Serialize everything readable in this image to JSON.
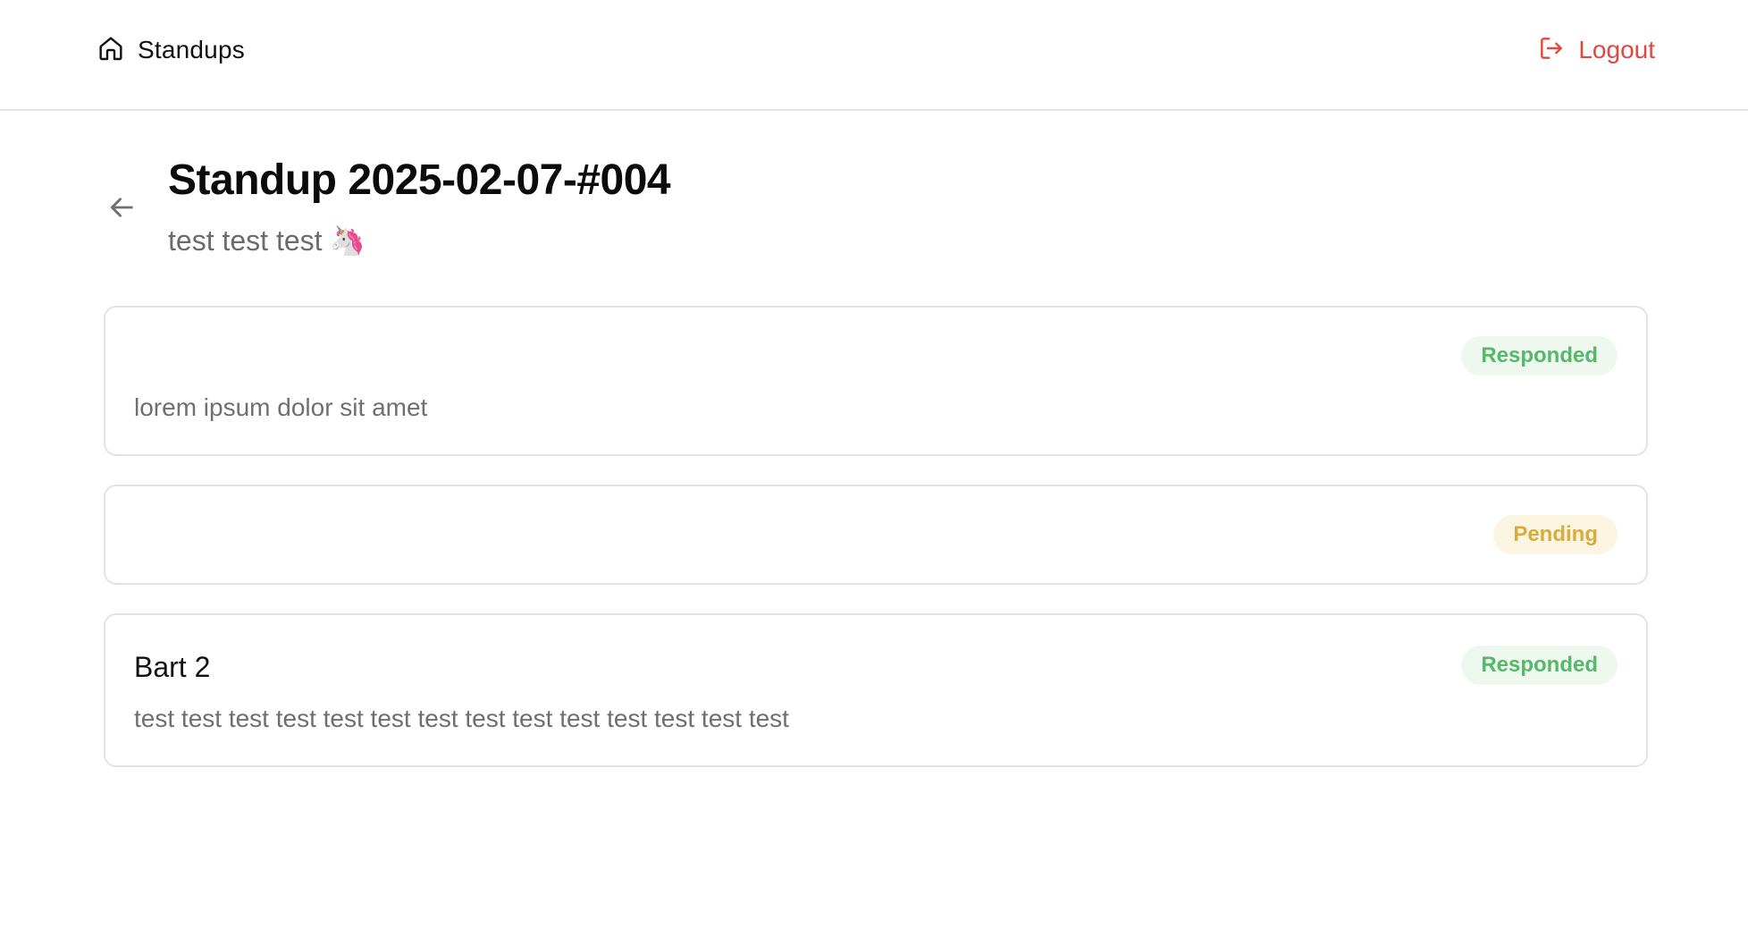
{
  "header": {
    "brand_label": "Standups",
    "logout_label": "Logout"
  },
  "page": {
    "title": "Standup 2025-02-07-#004",
    "subtitle": "test test test 🦄"
  },
  "responses": [
    {
      "name": "",
      "status": "Responded",
      "text": "lorem ipsum dolor sit amet"
    },
    {
      "name": "",
      "status": "Pending",
      "text": ""
    },
    {
      "name": "Bart 2",
      "status": "Responded",
      "text": "test test test test test test test test test test test test test test"
    }
  ],
  "colors": {
    "logout": "#e0473f",
    "responded_text": "#55b86a",
    "responded_bg": "#eef8ee",
    "pending_text": "#d7ad3c",
    "pending_bg": "#fbf5e2"
  },
  "icons": {
    "brand": "home-icon",
    "logout": "logout-icon",
    "back": "arrow-left-icon"
  }
}
